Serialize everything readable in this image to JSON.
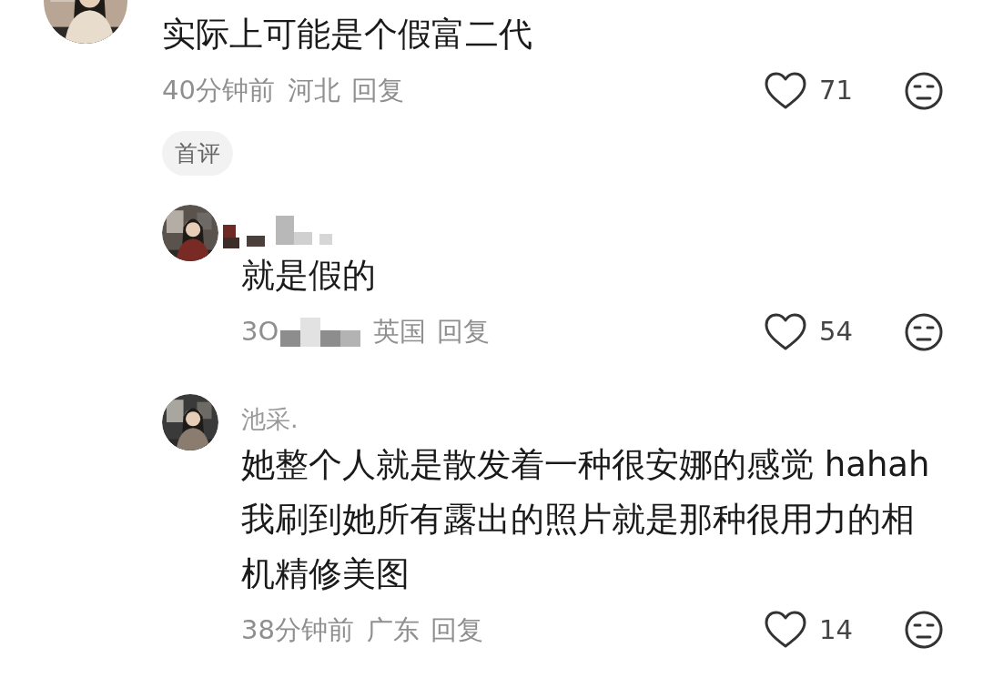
{
  "comment": {
    "text": "实际上可能是个假富二代",
    "time": "40分钟前",
    "region": "河北",
    "reply_label": "回复",
    "likes": "71",
    "badge": "首评"
  },
  "replies": [
    {
      "name_hidden": true,
      "text": "就是假的",
      "time": "3O",
      "time_hidden": true,
      "region": "英国",
      "reply_label": "回复",
      "likes": "54"
    },
    {
      "name_hidden": false,
      "name": "池采.",
      "text": "她整个人就是散发着一种很安娜的感觉 hahah 我刷到她所有露出的照片就是那种很用力的相机精修美图",
      "time_hidden": false,
      "time": "38分钟前",
      "region": "广东",
      "reply_label": "回复",
      "likes": "14"
    }
  ]
}
